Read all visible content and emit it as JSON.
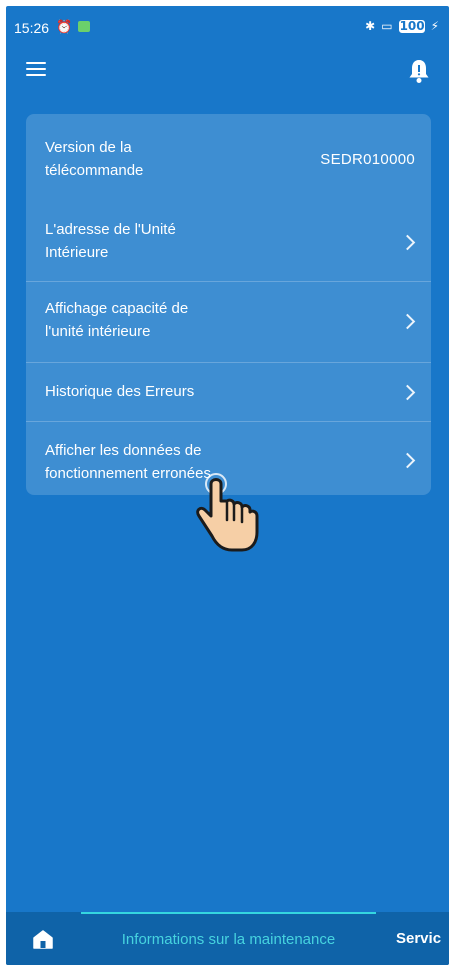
{
  "status_bar": {
    "time": "15:26",
    "battery": "100"
  },
  "header": {
    "menu_icon": "hamburger-menu-icon",
    "notification_icon": "bell-icon"
  },
  "maintenance_list": {
    "items": [
      {
        "label_line1": "Version de la",
        "label_line2": "télécommande",
        "value": "SEDR010000"
      },
      {
        "label_line1": "L'adresse de l'Unité",
        "label_line2": "Intérieure"
      },
      {
        "label_line1": "Affichage capacité de",
        "label_line2": "l'unité intérieure"
      },
      {
        "label_line1": "Historique des Erreurs"
      },
      {
        "label_line1": "Afficher les données de",
        "label_line2": "fonctionnement erronées"
      }
    ]
  },
  "bottom_nav": {
    "home_icon": "home-icon",
    "active_tab": "Informations sur la maintenance",
    "next_tab": "Servic"
  },
  "colors": {
    "background": "#1877c9",
    "active_tab_text": "#46d3df",
    "nav_bar": "#0f63a8"
  }
}
